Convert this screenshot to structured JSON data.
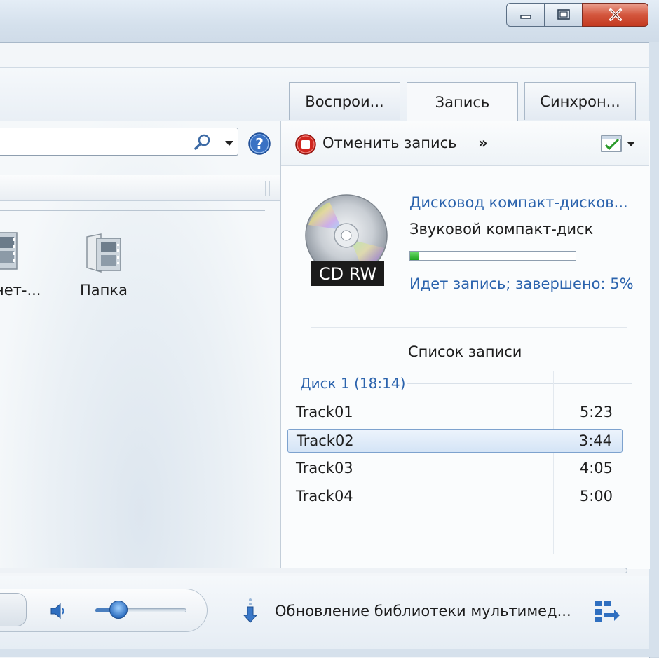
{
  "window": {
    "caption_buttons": {
      "minimize": "minimize-icon",
      "maximize": "maximize-icon",
      "close": "close-icon"
    }
  },
  "tabs": [
    {
      "label": "Воспрои...",
      "active": false
    },
    {
      "label": "Запись",
      "active": true
    },
    {
      "label": "Синхрон...",
      "active": false
    }
  ],
  "library": {
    "items": [
      {
        "label": "нет-...",
        "icon": "internet-video-icon"
      },
      {
        "label": "Папка",
        "icon": "folder-icon"
      }
    ]
  },
  "burn": {
    "cancel_label": "Отменить запись",
    "more_label": "»",
    "drive_name": "Дисковод компакт-дисков...",
    "disc_type": "Звуковой компакт-диск",
    "disc_badge": "CD RW",
    "progress_percent": 5,
    "status": "Идет запись; завершено: 5%",
    "list_title": "Список записи",
    "disk_header": "Диск 1 (18:14)",
    "tracks": [
      {
        "name": "Track01",
        "length": "5:23",
        "selected": false
      },
      {
        "name": "Track02",
        "length": "3:44",
        "selected": true
      },
      {
        "name": "Track03",
        "length": "4:05",
        "selected": false
      },
      {
        "name": "Track04",
        "length": "5:00",
        "selected": false
      }
    ]
  },
  "player": {
    "volume_level": 0.25,
    "status_text": "Обновление библиотеки мультимед..."
  },
  "colors": {
    "link_blue": "#2b63ad",
    "close_red": "#c4391f",
    "progress_green": "#1fa41f"
  }
}
